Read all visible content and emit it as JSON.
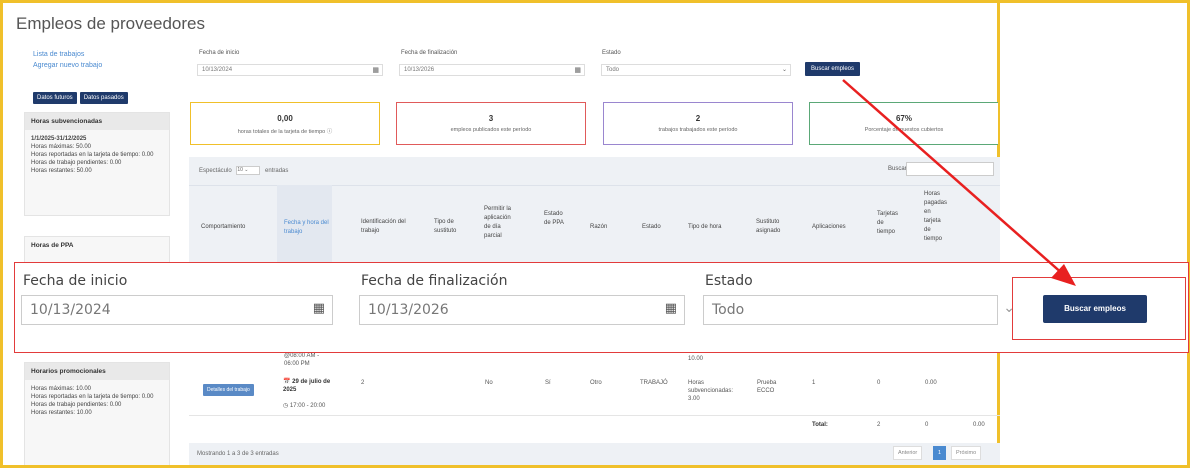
{
  "page": {
    "title": "Empleos de proveedores"
  },
  "sidebar": {
    "links": [
      "Lista de trabajos",
      "Agregar nuevo trabajo"
    ],
    "buttons": [
      "Datos futuros",
      "Datos pasados"
    ],
    "box1": {
      "title": "Horas subvencionadas",
      "dates": "1/1/2025-31/12/2025",
      "lines": [
        "Horas máximas: 50.00",
        "Horas reportadas en la tarjeta de tiempo: 0.00",
        "Horas de trabajo pendientes: 0.00",
        "Horas restantes: 50.00"
      ]
    },
    "box2": {
      "title": "Horas de PPA"
    },
    "box3": {
      "title": "Horarios promocionales",
      "lines": [
        "Horas máximas: 10.00",
        "Horas reportadas en la tarjeta de tiempo: 0.00",
        "Horas de trabajo pendientes: 0.00",
        "Horas restantes: 10.00"
      ]
    }
  },
  "filters": {
    "start_label": "Fecha de inicio",
    "start_value": "10/13/2024",
    "end_label": "Fecha de finalización",
    "end_value": "10/13/2026",
    "state_label": "Estado",
    "state_value": "Todo",
    "search_button": "Buscar empleos"
  },
  "cards": [
    {
      "value": "0,00",
      "label": "horas totales de la tarjeta de tiempo",
      "color": "#f0c02a"
    },
    {
      "value": "3",
      "label": "empleos publicados este período",
      "color": "#e05a5a"
    },
    {
      "value": "2",
      "label": "trabajos trabajados este período",
      "color": "#9a86cf"
    },
    {
      "value": "67%",
      "label": "Porcentaje de puestos cubiertos",
      "color": "#5ba877"
    }
  ],
  "table": {
    "show_label": "Espectáculo",
    "show_value": "10",
    "entries_label": "entradas",
    "search_label": "Buscar:",
    "headers": [
      "Comportamiento",
      "Fecha y hora del trabajo",
      "Identificación del trabajo",
      "Tipo de sustituto",
      "Permitir la aplicación de día parcial",
      "Estado de PPA",
      "Razón",
      "Estado",
      "Tipo de hora",
      "Sustituto asignado",
      "Aplicaciones",
      "Tarjetas de tiempo",
      "Horas pagadas en tarjeta de tiempo"
    ],
    "row_partial": {
      "time": "@08:00 AM - 06:00 PM",
      "hours": "10.00"
    },
    "row": {
      "action": "Detalles del trabajo",
      "date": "29 de julio de 2025",
      "time": "17:00 - 20:00",
      "id": "2",
      "partial": "No",
      "ppa": "Sí",
      "reason": "Otro",
      "state": "TRABAJÓ",
      "hour_type": "Horas subvencionadas: 3.00",
      "assigned": "Prueba ECCO",
      "applications": "1",
      "timecards": "0",
      "paid": "0.00"
    },
    "total": {
      "label": "Total:",
      "timecards_tot": "2",
      "apps_tot": "0",
      "paid_tot": "0.00"
    },
    "footer": "Mostrando 1 a 3 de 3 entradas",
    "pagination": {
      "prev": "Anterior",
      "current": "1",
      "next": "Próximo"
    }
  }
}
